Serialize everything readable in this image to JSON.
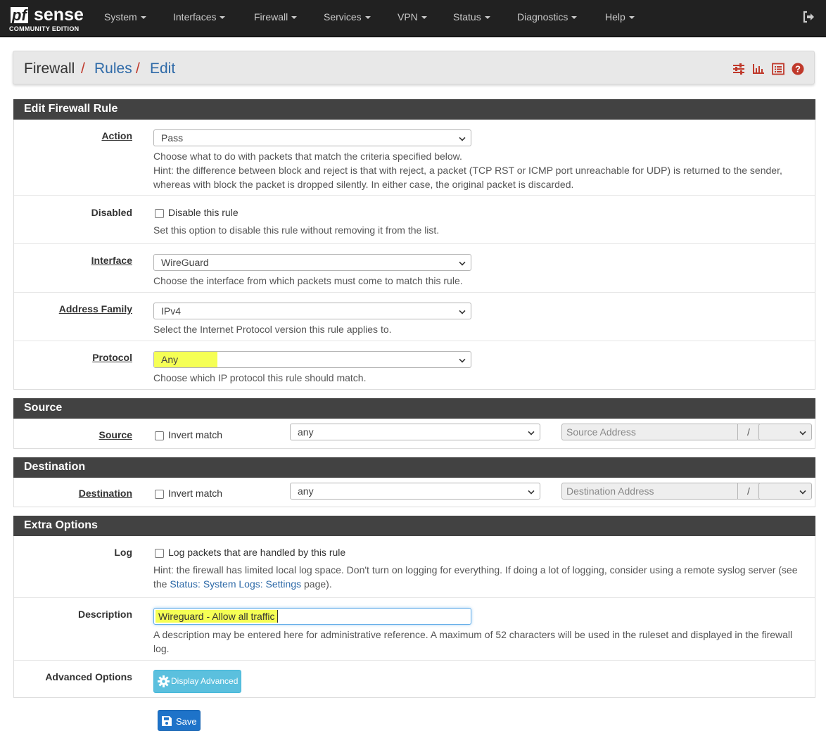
{
  "brand": {
    "pf": "pf",
    "sense": "sense",
    "edition": "COMMUNITY EDITION"
  },
  "nav": [
    "System",
    "Interfaces",
    "Firewall",
    "Services",
    "VPN",
    "Status",
    "Diagnostics",
    "Help"
  ],
  "breadcrumb": {
    "root": "Firewall",
    "sep": "/",
    "rules": "Rules",
    "edit": "Edit"
  },
  "sections": {
    "edit": "Edit Firewall Rule",
    "source": "Source",
    "destination": "Destination",
    "extra": "Extra Options"
  },
  "action": {
    "label": "Action",
    "value": "Pass",
    "help1": "Choose what to do with packets that match the criteria specified below.",
    "help2": "Hint: the difference between block and reject is that with reject, a packet (TCP RST or ICMP port unreachable for UDP) is returned to the sender,",
    "help3": "whereas with block the packet is dropped silently. In either case, the original packet is discarded."
  },
  "disabled": {
    "label": "Disabled",
    "checkbox": "Disable this rule",
    "help": "Set this option to disable this rule without removing it from the list."
  },
  "interface": {
    "label": "Interface",
    "value": "WireGuard",
    "help": "Choose the interface from which packets must come to match this rule."
  },
  "address_family": {
    "label": "Address Family",
    "value": "IPv4",
    "help": "Select the Internet Protocol version this rule applies to."
  },
  "protocol": {
    "label": "Protocol",
    "value": "Any",
    "help": "Choose which IP protocol this rule should match."
  },
  "source": {
    "label": "Source",
    "invert": "Invert match",
    "type": "any",
    "placeholder": "Source Address",
    "slash": "/"
  },
  "destination": {
    "label": "Destination",
    "invert": "Invert match",
    "type": "any",
    "placeholder": "Destination Address",
    "slash": "/"
  },
  "log": {
    "label": "Log",
    "checkbox": "Log packets that are handled by this rule",
    "help1": "Hint: the firewall has limited local log space. Don't turn on logging for everything. If doing a lot of logging, consider using a remote syslog server (see",
    "help2_pre": "the",
    "help2_link": "Status: System Logs: Settings",
    "help2_post": "page)."
  },
  "description": {
    "label": "Description",
    "value": "Wireguard - Allow all traffic",
    "help1": "A description may be entered here for administrative reference. A maximum of 52 characters will be used in the ruleset and displayed in the firewall",
    "help2": "log."
  },
  "advanced": {
    "label": "Advanced Options",
    "button": "Display Advanced"
  },
  "save": {
    "button": "Save"
  },
  "colors": {
    "navbar": "#212121",
    "panel_head": "#424242",
    "link": "#2e6aa8",
    "header_icons": "#c0392b",
    "highlight": "#f5ff55",
    "info_button": "#5bc0de",
    "save_button": "#1e73c9"
  }
}
